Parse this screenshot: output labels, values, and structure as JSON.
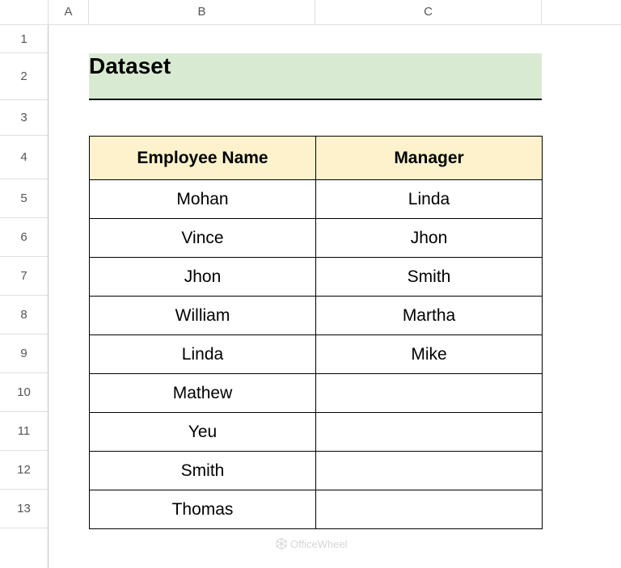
{
  "columns": [
    "A",
    "B",
    "C"
  ],
  "rows": [
    "1",
    "2",
    "3",
    "4",
    "5",
    "6",
    "7",
    "8",
    "9",
    "10",
    "11",
    "12",
    "13"
  ],
  "title": "Dataset",
  "headers": {
    "employee": "Employee Name",
    "manager": "Manager"
  },
  "data": [
    {
      "employee": "Mohan",
      "manager": "Linda"
    },
    {
      "employee": "Vince",
      "manager": "Jhon"
    },
    {
      "employee": "Jhon",
      "manager": "Smith"
    },
    {
      "employee": "William",
      "manager": "Martha"
    },
    {
      "employee": "Linda",
      "manager": "Mike"
    },
    {
      "employee": "Mathew",
      "manager": ""
    },
    {
      "employee": "Yeu",
      "manager": ""
    },
    {
      "employee": "Smith",
      "manager": ""
    },
    {
      "employee": "Thomas",
      "manager": ""
    }
  ],
  "watermark": "OfficeWheel"
}
